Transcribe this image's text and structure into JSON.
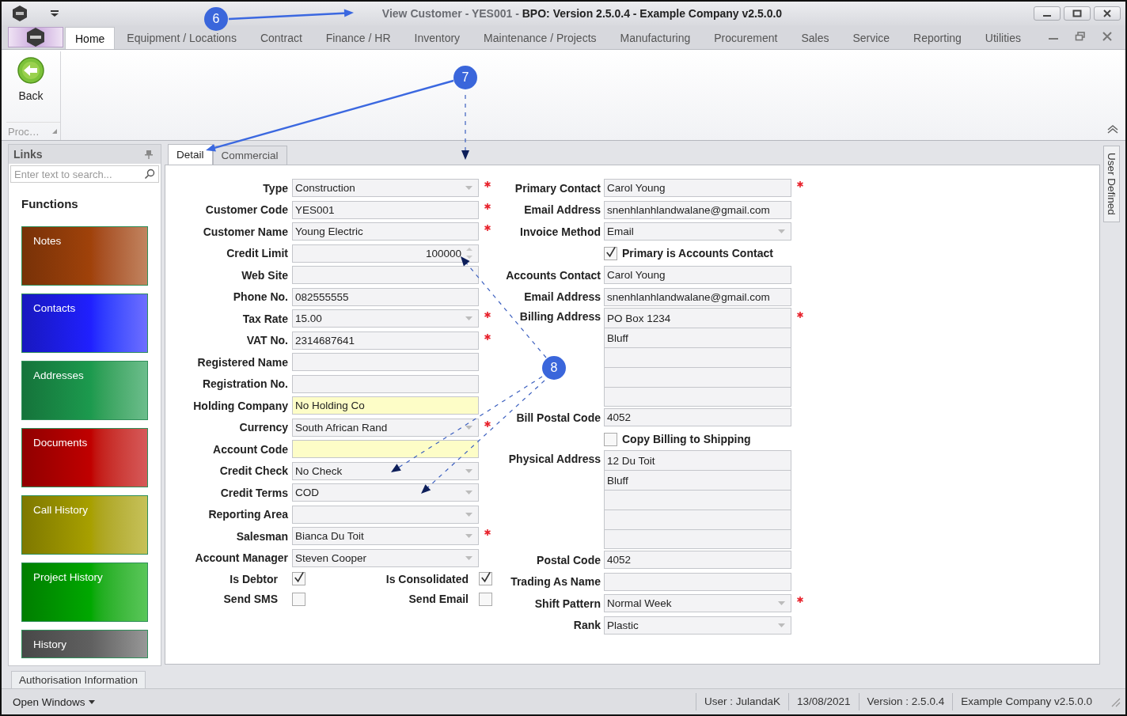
{
  "title_bar": {
    "title": "View Customer - YES001 - **BPO: Version 2.5.0.4 - Example Company v2.5.0.0**"
  },
  "menu_tabs": [
    {
      "label": "Home",
      "selected": true
    },
    {
      "label": "Equipment / Locations",
      "selected": false
    },
    {
      "label": "Contract",
      "selected": false
    },
    {
      "label": "Finance / HR",
      "selected": false
    },
    {
      "label": "Inventory",
      "selected": false
    },
    {
      "label": "Maintenance / Projects",
      "selected": false
    },
    {
      "label": "Manufacturing",
      "selected": false
    },
    {
      "label": "Procurement",
      "selected": false
    },
    {
      "label": "Sales",
      "selected": false
    },
    {
      "label": "Service",
      "selected": false
    },
    {
      "label": "Reporting",
      "selected": false
    },
    {
      "label": "Utilities",
      "selected": false
    }
  ],
  "ribbon": {
    "back_label": "Back",
    "group_label": "Proc…"
  },
  "links": {
    "title": "Links",
    "search": {
      "placeholder": "Enter text to search..."
    },
    "heading": "Functions",
    "tiles": [
      {
        "label": "Notes",
        "color": "#a0420a"
      },
      {
        "label": "Contacts",
        "color": "#2020ff"
      },
      {
        "label": "Addresses",
        "color": "#1c9a4e"
      },
      {
        "label": "Documents",
        "color": "#c00000"
      },
      {
        "label": "Call History",
        "color": "#a8a000"
      },
      {
        "label": "Project History",
        "color": "#00a800"
      },
      {
        "label": "History",
        "color": "#606060"
      }
    ]
  },
  "form_tabs": [
    {
      "label": "Detail",
      "selected": true
    },
    {
      "label": "Commercial",
      "selected": false
    }
  ],
  "side_tab": {
    "label": "User Defined"
  },
  "left_fields": [
    {
      "kind": "combo",
      "label": "Type",
      "value": "Construction",
      "required": true,
      "highlighted": false
    },
    {
      "kind": "text",
      "label": "Customer Code",
      "value": "YES001",
      "required": true,
      "highlighted": false
    },
    {
      "kind": "text",
      "label": "Customer Name",
      "value": "Young Electric",
      "required": true,
      "highlighted": false
    },
    {
      "kind": "spin",
      "label": "Credit Limit",
      "value": "100000",
      "required": false,
      "highlighted": false
    },
    {
      "kind": "text",
      "label": "Web Site",
      "required": false,
      "highlighted": false
    },
    {
      "kind": "text",
      "label": "Phone No.",
      "value": "082555555",
      "required": false,
      "highlighted": false
    },
    {
      "kind": "combo",
      "label": "Tax Rate",
      "value": "15.00",
      "required": true,
      "highlighted": false
    },
    {
      "kind": "text",
      "label": "VAT No.",
      "value": "2314687641",
      "required": true,
      "highlighted": false
    },
    {
      "kind": "text",
      "label": "Registered Name",
      "required": false,
      "highlighted": false
    },
    {
      "kind": "text",
      "label": "Registration No.",
      "required": false,
      "highlighted": false
    },
    {
      "kind": "text",
      "label": "Holding Company",
      "value": "No Holding Co",
      "required": false,
      "highlighted": true
    },
    {
      "kind": "combo",
      "label": "Currency",
      "value": "South African Rand",
      "required": true,
      "highlighted": false
    },
    {
      "kind": "text",
      "label": "Account Code",
      "required": false,
      "highlighted": true
    },
    {
      "kind": "combo",
      "label": "Credit Check",
      "value": "No Check",
      "required": false,
      "highlighted": false
    },
    {
      "kind": "combo",
      "label": "Credit Terms",
      "value": "COD",
      "required": false,
      "highlighted": false
    },
    {
      "kind": "combo",
      "label": "Reporting Area",
      "required": false,
      "highlighted": false
    },
    {
      "kind": "combo",
      "label": "Salesman",
      "value": "Bianca Du Toit",
      "required": true,
      "highlighted": false
    },
    {
      "kind": "combo",
      "label": "Account Manager",
      "value": "Steven Cooper",
      "required": false,
      "highlighted": false
    }
  ],
  "left_checks": [
    [
      {
        "label": "Is Debtor",
        "checked": true
      },
      {
        "label": "Is Consolidated",
        "checked": true
      }
    ],
    [
      {
        "label": "Send SMS",
        "checked": false
      },
      {
        "label": "Send Email",
        "checked": false
      }
    ]
  ],
  "right_fields": [
    {
      "kind": "text",
      "label": "Primary Contact",
      "value": "Carol Young",
      "required": true
    },
    {
      "kind": "text",
      "label": "Email Address",
      "value": "snenhlanhlandwalane@gmail.com",
      "required": false
    },
    {
      "kind": "combo",
      "label": "Invoice Method",
      "value": "Email",
      "required": false
    },
    {
      "kind": "check",
      "label": "Primary is Accounts Contact",
      "checked": true
    },
    {
      "kind": "text",
      "label": "Accounts Contact",
      "value": "Carol Young",
      "required": false
    },
    {
      "kind": "text",
      "label": "Email Address",
      "value": "snenhlanhlandwalane@gmail.com",
      "required": false
    },
    {
      "kind": "address",
      "label": "Billing Address",
      "required": true,
      "lines": [
        "PO Box 1234",
        "Bluff"
      ]
    },
    {
      "kind": "text",
      "label": "Bill Postal Code",
      "value": "4052",
      "required": false
    },
    {
      "kind": "check",
      "label": "Copy Billing to Shipping",
      "checked": false
    },
    {
      "kind": "address",
      "label": "Physical Address",
      "required": false,
      "lines": [
        "12 Du Toit",
        "Bluff"
      ]
    },
    {
      "kind": "text",
      "label": "Postal Code",
      "value": "4052",
      "required": false
    },
    {
      "kind": "text",
      "label": "Trading As Name",
      "required": false
    },
    {
      "kind": "combo",
      "label": "Shift Pattern",
      "value": "Normal Week",
      "required": true
    },
    {
      "kind": "combo",
      "label": "Rank",
      "value": "Plastic",
      "required": false
    }
  ],
  "bottom_tabs": [
    {
      "label": "Authorisation Information"
    }
  ],
  "status_bar": {
    "open_windows": "Open Windows",
    "items": [
      "User : JulandaK",
      "13/08/2021",
      "Version : 2.5.0.4",
      "Example Company v2.5.0.0"
    ]
  },
  "annotations": [
    {
      "label": "6"
    },
    {
      "label": "7"
    },
    {
      "label": "8"
    }
  ]
}
